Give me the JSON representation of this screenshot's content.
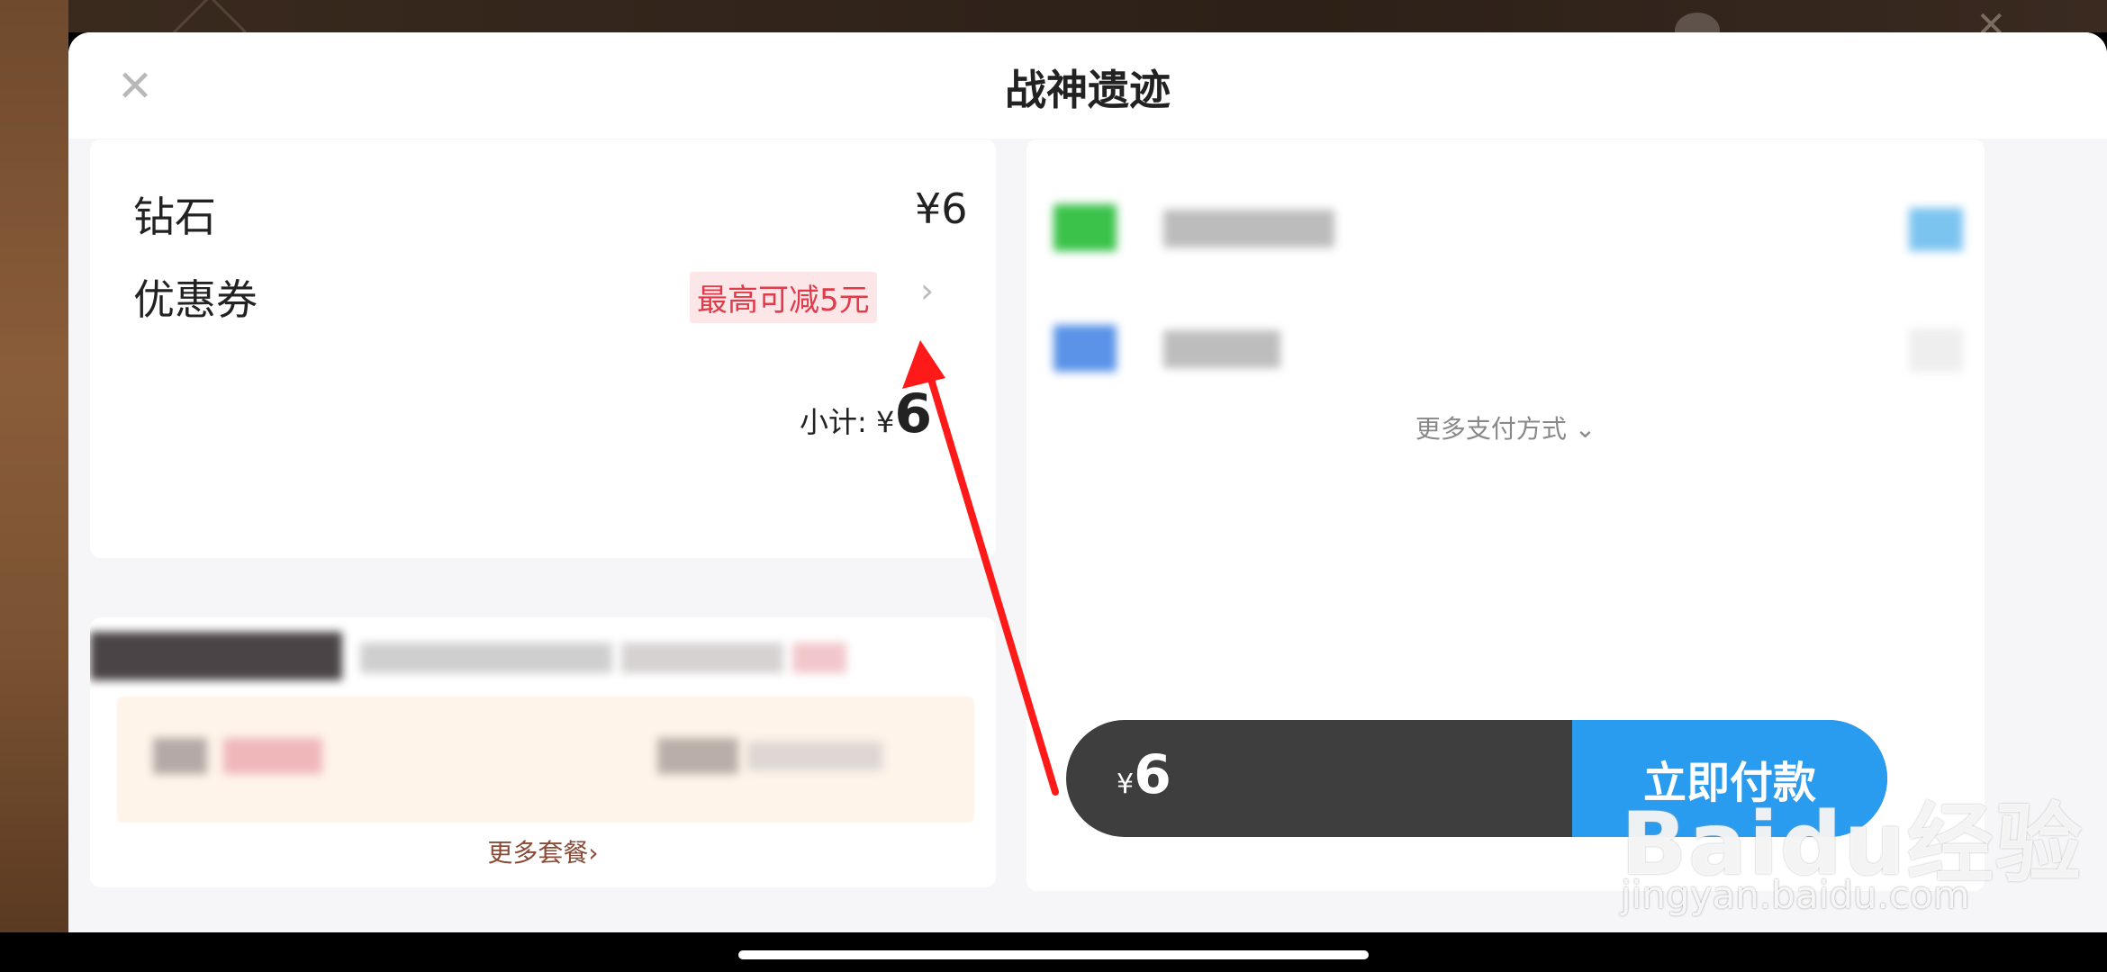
{
  "modal": {
    "title": "战神遗迹",
    "close_icon": "close-icon"
  },
  "order": {
    "item_label": "钻石",
    "item_price": "¥6",
    "coupon_label": "优惠券",
    "coupon_badge": "最高可减5元",
    "coupon_chevron": "›",
    "subtotal_label": "小计: ¥",
    "subtotal_value": "6"
  },
  "packages": {
    "more_label": "更多套餐›"
  },
  "payment": {
    "more_label": "更多支付方式 ⌄",
    "total_currency": "¥",
    "total_value": "6",
    "pay_button": "立即付款"
  },
  "watermark": {
    "brand": "Baidu经验",
    "url": "jingyan.baidu.com"
  },
  "colors": {
    "accent_blue": "#2a9cf0",
    "coupon_red": "#e33a4a",
    "pay_bar_dark": "#3e3e3e",
    "annotation_arrow": "#ff1a1a"
  }
}
